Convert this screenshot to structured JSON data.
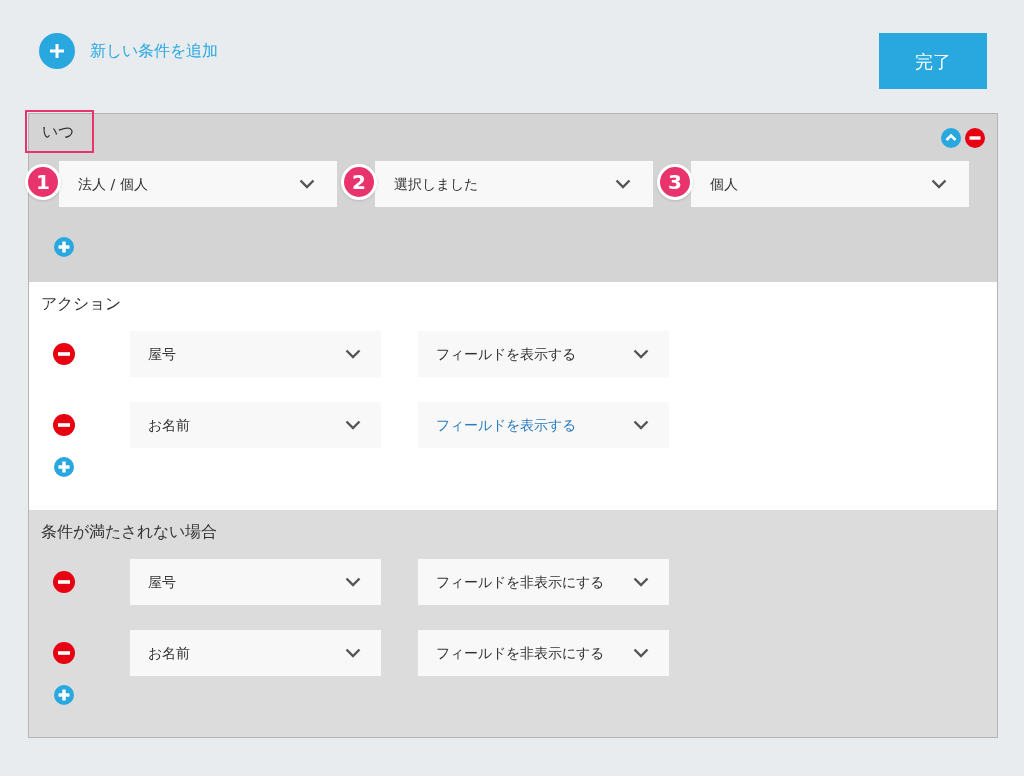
{
  "add_condition": {
    "label": "新しい条件を追加"
  },
  "done_button": {
    "label": "完了"
  },
  "when": {
    "title": "いつ",
    "highlighted": true,
    "conditions": [
      {
        "marker": "1",
        "value": "法人 / 個人"
      },
      {
        "marker": "2",
        "value": "選択しました"
      },
      {
        "marker": "3",
        "value": "個人"
      }
    ]
  },
  "sections": [
    {
      "title": "アクション",
      "rows": [
        {
          "field": "屋号",
          "action": "フィールドを表示する",
          "focused": false
        },
        {
          "field": "お名前",
          "action": "フィールドを表示する",
          "focused": true
        }
      ]
    },
    {
      "title": "条件が満たされない場合",
      "rows": [
        {
          "field": "屋号",
          "action": "フィールドを非表示にする",
          "focused": false
        },
        {
          "field": "お名前",
          "action": "フィールドを非表示にする",
          "focused": false
        }
      ]
    }
  ]
}
